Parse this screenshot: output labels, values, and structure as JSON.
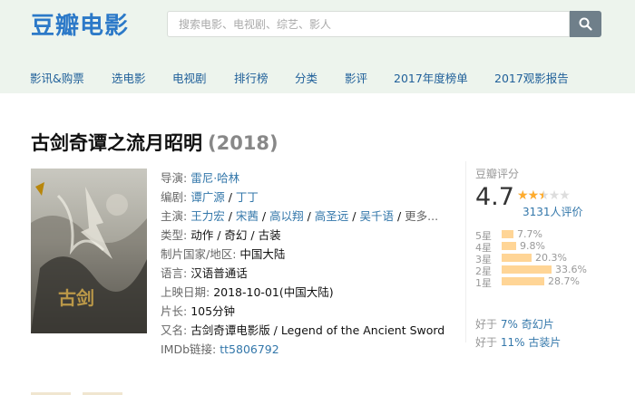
{
  "header": {
    "logo": "豆瓣电影",
    "search_placeholder": "搜索电影、电视剧、综艺、影人"
  },
  "nav": {
    "items": [
      "影讯&购票",
      "选电影",
      "电视剧",
      "排行榜",
      "分类",
      "影评",
      "2017年度榜单",
      "2017观影报告"
    ]
  },
  "movie": {
    "title": "古剑奇谭之流月昭明",
    "year": "(2018)",
    "director_label": "导演:",
    "director": "雷尼·哈林",
    "writer_label": "编剧:",
    "writers": [
      "谭广源",
      "丁丁"
    ],
    "cast_label": "主演:",
    "cast": [
      "王力宏",
      "宋茜",
      "高以翔",
      "高圣远",
      "吴千语"
    ],
    "cast_more": "更多...",
    "genre_label": "类型:",
    "genres": [
      "动作",
      "奇幻",
      "古装"
    ],
    "country_label": "制片国家/地区:",
    "country": "中国大陆",
    "language_label": "语言:",
    "language": "汉语普通话",
    "release_label": "上映日期:",
    "release": "2018-10-01(中国大陆)",
    "runtime_label": "片长:",
    "runtime": "105分钟",
    "aka_label": "又名:",
    "aka": "古剑奇谭电影版 / Legend of the Ancient Sword",
    "imdb_label": "IMDb链接:",
    "imdb": "tt5806792"
  },
  "rating": {
    "label": "豆瓣评分",
    "score": "4.7",
    "stars": 2.5,
    "votes": "3131人评价",
    "breakdown": [
      {
        "label": "5星",
        "pct": "7.7%",
        "value": 7.7
      },
      {
        "label": "4星",
        "pct": "9.8%",
        "value": 9.8
      },
      {
        "label": "3星",
        "pct": "20.3%",
        "value": 20.3
      },
      {
        "label": "2星",
        "pct": "33.6%",
        "value": 33.6
      },
      {
        "label": "1星",
        "pct": "28.7%",
        "value": 28.7
      }
    ],
    "better_than": [
      {
        "prefix": "好于 ",
        "pct": "7%",
        "genre": "奇幻片"
      },
      {
        "prefix": "好于 ",
        "pct": "11%",
        "genre": "古装片"
      }
    ]
  },
  "colors": {
    "brand": "#2c79c8",
    "link": "#3377aa",
    "star": "#ffac2d",
    "bar": "#ffd596"
  }
}
